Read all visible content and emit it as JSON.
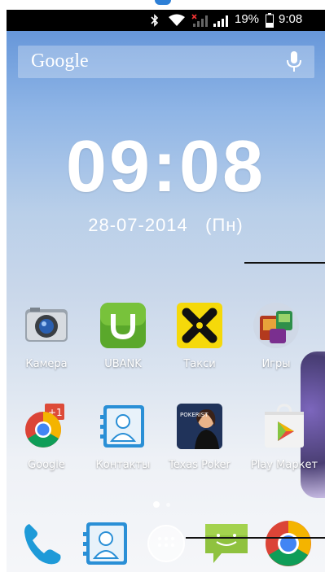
{
  "status_bar": {
    "battery_percent": "19%",
    "time": "9:08",
    "icons": [
      "bluetooth-icon",
      "wifi-icon",
      "signal-no-sim-icon",
      "signal-icon",
      "battery-icon"
    ]
  },
  "search": {
    "label": "Google",
    "mic_icon": "microphone-icon"
  },
  "clock": {
    "time": "09:08",
    "date": "28-07-2014",
    "weekday": "(Пн)"
  },
  "apps": [
    {
      "label": "Камера",
      "icon": "camera-icon"
    },
    {
      "label": "UBANK",
      "icon": "ubank-icon"
    },
    {
      "label": "Такси",
      "icon": "taxi-icon"
    },
    {
      "label": "Игры",
      "icon": "games-icon"
    },
    {
      "label": "Google",
      "icon": "google-icon"
    },
    {
      "label": "Контакты",
      "icon": "contacts-icon"
    },
    {
      "label": "Texas Poker",
      "icon": "texas-poker-icon"
    },
    {
      "label": "Play Маркет",
      "icon": "play-market-icon"
    }
  ],
  "dock": [
    "phone-icon",
    "contacts-icon",
    "app-drawer-icon",
    "messaging-icon",
    "chrome-icon"
  ],
  "pager": {
    "pages": 2,
    "current": 2
  }
}
